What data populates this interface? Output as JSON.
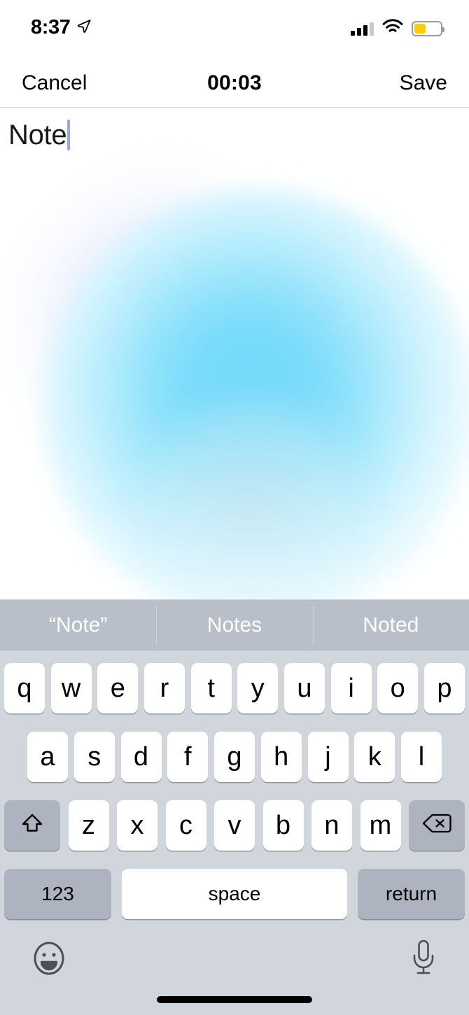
{
  "status_bar": {
    "time": "8:37",
    "location_icon": "location-arrow-icon",
    "signal_icon": "cellular-signal-icon",
    "signal_bars_filled": 3,
    "signal_bars_total": 4,
    "wifi_icon": "wifi-icon",
    "battery_icon": "battery-icon",
    "battery_level_percent": 40,
    "battery_color": "#FFCC00",
    "low_power_mode": true
  },
  "nav_bar": {
    "cancel_label": "Cancel",
    "timer_label": "00:03",
    "save_label": "Save"
  },
  "note_editor": {
    "text": "Note",
    "caret_visible": true,
    "caret_color": "#9AA7E8",
    "background_blob_color": "#79DCFA",
    "background_blob_secondary_color": "#B0BAF8"
  },
  "predictive_bar": {
    "suggestions": [
      {
        "label": "“Note”"
      },
      {
        "label": "Notes"
      },
      {
        "label": "Noted"
      }
    ],
    "background_color": "#B9BFC9",
    "text_color": "#FFFFFF"
  },
  "keyboard": {
    "background_color": "#D1D5DC",
    "key_color": "#FFFFFF",
    "modifier_key_color": "#AEB4BF",
    "row1": [
      "q",
      "w",
      "e",
      "r",
      "t",
      "y",
      "u",
      "i",
      "o",
      "p"
    ],
    "row2": [
      "a",
      "s",
      "d",
      "f",
      "g",
      "h",
      "j",
      "k",
      "l"
    ],
    "row3": {
      "shift_icon": "shift-arrow-icon",
      "letters": [
        "z",
        "x",
        "c",
        "v",
        "b",
        "n",
        "m"
      ],
      "delete_icon": "backspace-delete-icon"
    },
    "row4": {
      "numeric_label": "123",
      "space_label": "space",
      "return_label": "return"
    },
    "bottom_bar": {
      "emoji_icon": "emoji-smiley-icon",
      "dictation_icon": "microphone-icon"
    }
  },
  "home_indicator": {
    "visible": true
  }
}
